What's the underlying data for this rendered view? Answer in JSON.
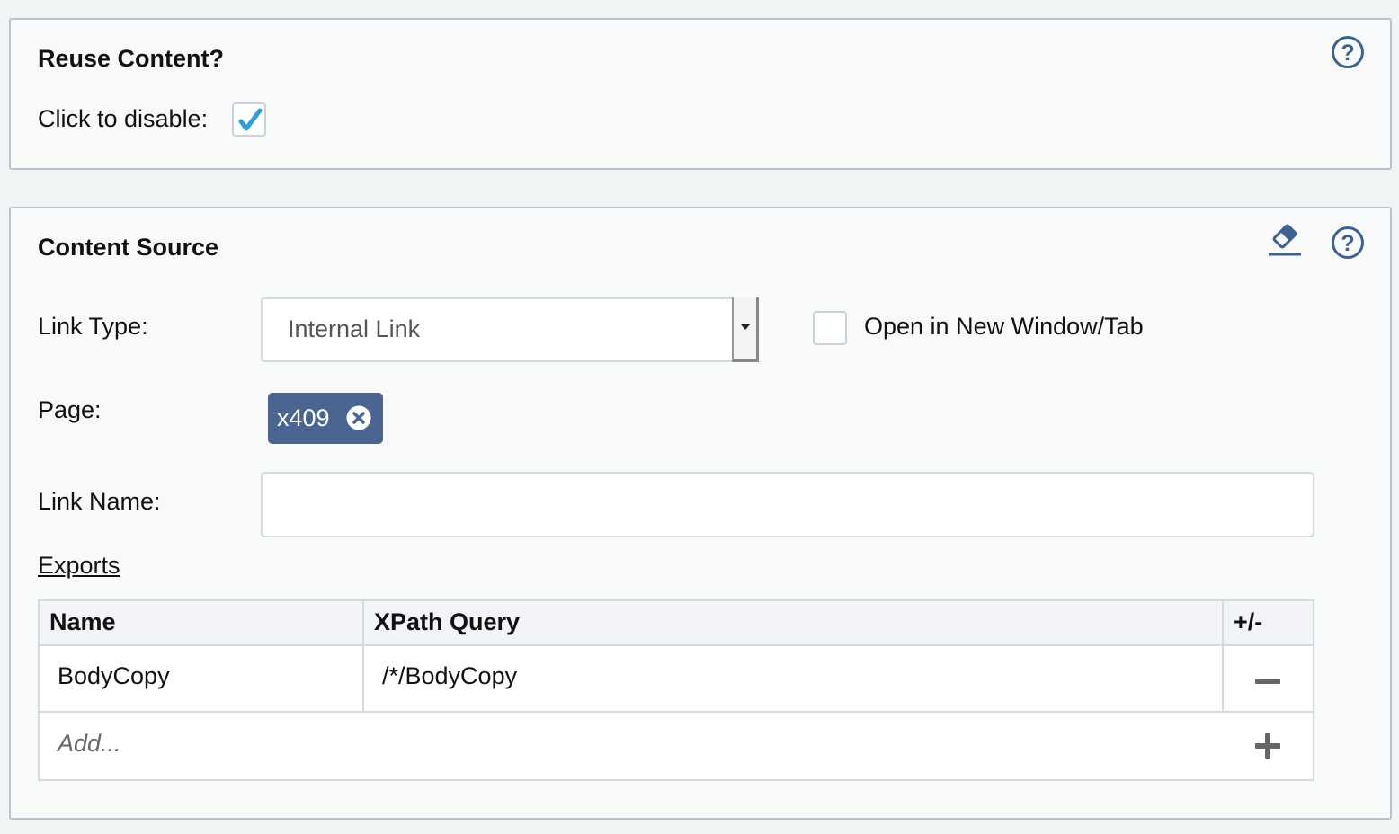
{
  "reuse_panel": {
    "title": "Reuse Content?",
    "disable_label": "Click to disable:",
    "disable_checked": true,
    "help_icon": "question-circle-icon",
    "check_color": "#2a9fd8"
  },
  "source_panel": {
    "title": "Content Source",
    "clear_icon": "eraser-icon",
    "help_icon": "question-circle-icon",
    "link_type_label": "Link Type:",
    "link_type_value": "Internal Link",
    "new_window_label": "Open in New Window/Tab",
    "new_window_checked": false,
    "page_label": "Page:",
    "page_tag": "x409",
    "link_name_label": "Link Name:",
    "link_name_value": "",
    "exports_label": "Exports",
    "tag_color": "#4a6690"
  },
  "exports_table": {
    "headers": [
      "Name",
      "XPath Query",
      "+/-"
    ],
    "rows": [
      {
        "name": "BodyCopy",
        "xpath": "/*/BodyCopy"
      }
    ],
    "add_placeholder": "Add..."
  }
}
